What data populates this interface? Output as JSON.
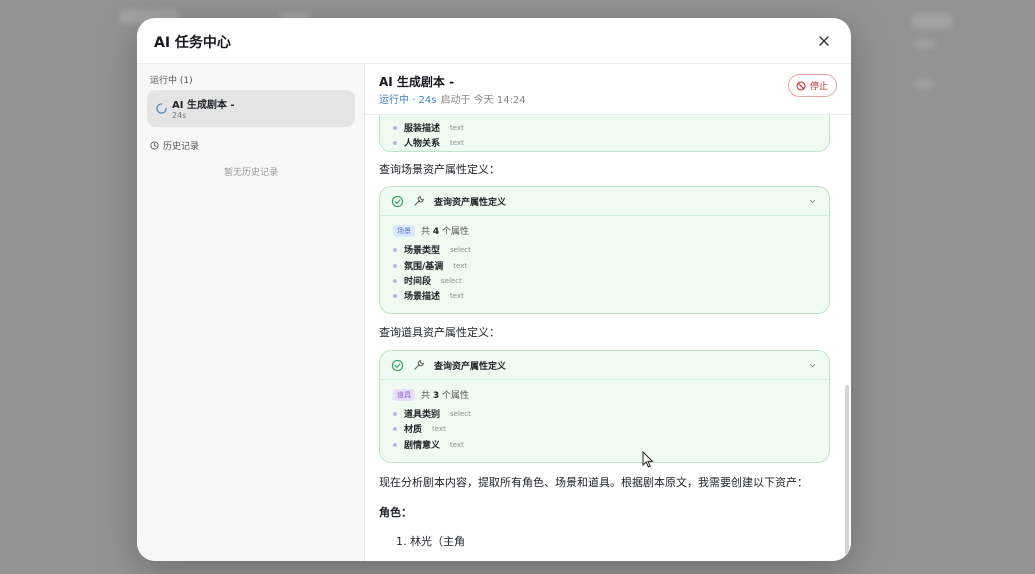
{
  "modal": {
    "title": "AI 任务中心"
  },
  "sidebar": {
    "running_header": "运行中 (1)",
    "task": {
      "title": "AI 生成剧本 -",
      "elapsed": "24s"
    },
    "history_header": "历史记录",
    "empty_history": "暂无历史记录"
  },
  "main": {
    "title": "AI 生成剧本 -",
    "status": "运行中 · 24s",
    "started": "启动于 今天 14:24",
    "stop_label": "停止"
  },
  "content": {
    "top_card_attrs": [
      {
        "name": "服装描述",
        "type": "text"
      },
      {
        "name": "人物关系",
        "type": "text"
      }
    ],
    "scene_heading": "查询场景资产属性定义：",
    "scene_card": {
      "label": "查询资产属性定义",
      "tag": "场景",
      "count_prefix": "共",
      "count": "4",
      "count_suffix": "个属性",
      "attrs": [
        {
          "name": "场景类型",
          "type": "select"
        },
        {
          "name": "氛围/基调",
          "type": "text"
        },
        {
          "name": "时间段",
          "type": "select"
        },
        {
          "name": "场景描述",
          "type": "text"
        }
      ]
    },
    "prop_heading": "查询道具资产属性定义：",
    "prop_card": {
      "label": "查询资产属性定义",
      "tag": "道具",
      "count_prefix": "共",
      "count": "3",
      "count_suffix": "个属性",
      "attrs": [
        {
          "name": "道具类别",
          "type": "select"
        },
        {
          "name": "材质",
          "type": "text"
        },
        {
          "name": "剧情意义",
          "type": "text"
        }
      ]
    },
    "analysis": "现在分析剧本内容，提取所有角色、场景和道具。根据剧本原文，我需要创建以下资产：",
    "roles_heading": "角色：",
    "role_item": "1. 林光（主角"
  }
}
